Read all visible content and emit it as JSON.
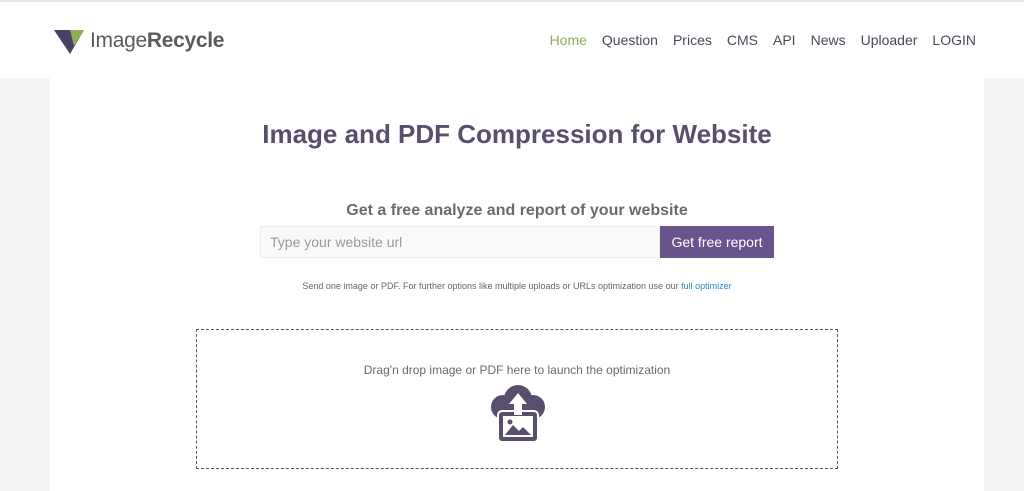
{
  "header": {
    "logo": {
      "part1": "Image",
      "part2": "Recycle"
    },
    "nav": [
      {
        "label": "Home",
        "active": true
      },
      {
        "label": "Question",
        "active": false
      },
      {
        "label": "Prices",
        "active": false
      },
      {
        "label": "CMS",
        "active": false
      },
      {
        "label": "API",
        "active": false
      },
      {
        "label": "News",
        "active": false
      },
      {
        "label": "Uploader",
        "active": false
      },
      {
        "label": "LOGIN",
        "active": false
      }
    ]
  },
  "main": {
    "title": "Image and PDF Compression for Website",
    "subtitle": "Get a free analyze and report of your website",
    "url_input": {
      "placeholder": "Type your website url",
      "value": ""
    },
    "report_button": "Get free report",
    "note": {
      "text": "Send one image or PDF. For further options like multiple uploads or URLs optimization use our ",
      "link": "full optimizer"
    },
    "dropzone": {
      "text": "Drag'n drop image or PDF here to launch the optimization",
      "icon": "cloud-upload-image-icon"
    }
  },
  "colors": {
    "accent_purple": "#6a548e",
    "nav_active": "#8eaf4f",
    "link_blue": "#2a86c9",
    "title_color": "#5a4e6e"
  }
}
